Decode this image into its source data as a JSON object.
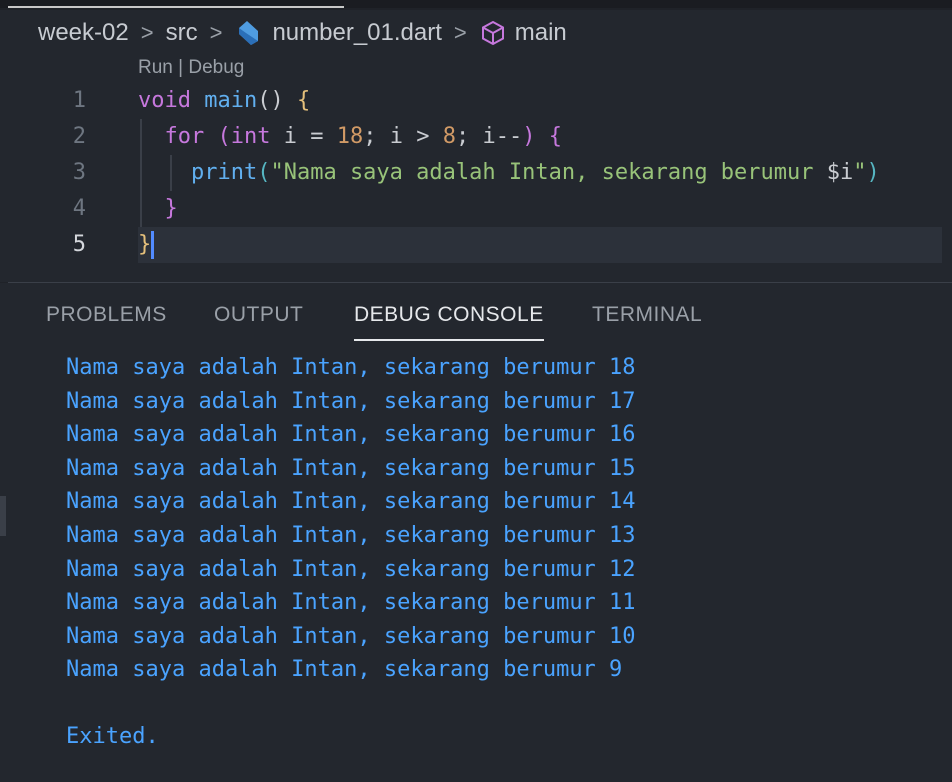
{
  "breadcrumb": {
    "folder1": "week-02",
    "folder2": "src",
    "file": "number_01.dart",
    "symbol": "main",
    "separator": ">"
  },
  "editor": {
    "codelens": {
      "run": "Run",
      "separator": " | ",
      "debug": "Debug"
    },
    "line_numbers": [
      "1",
      "2",
      "3",
      "4",
      "5"
    ],
    "active_line": 5,
    "lines": {
      "l1": {
        "kw": "void",
        "fn": "main",
        "paren": "()",
        "brace": "{"
      },
      "l2": {
        "kw": "for",
        "open": "(",
        "type": "int",
        "var": "i",
        "eq": "=",
        "start": "18",
        "semi1": ";",
        "var2": "i",
        "gt": ">",
        "end": "8",
        "semi2": ";",
        "dec": "i--",
        "close": ")",
        "brace": "{"
      },
      "l3": {
        "fn": "print",
        "open": "(",
        "str": "\"Nama saya adalah Intan, sekarang berumur ",
        "interp": "$i",
        "strend": "\"",
        "close": ")"
      },
      "l4": {
        "brace": "}"
      },
      "l5": {
        "brace": "}"
      }
    }
  },
  "panel": {
    "tabs": [
      "PROBLEMS",
      "OUTPUT",
      "DEBUG CONSOLE",
      "TERMINAL"
    ],
    "active_tab": "DEBUG CONSOLE",
    "output": [
      "Nama saya adalah Intan, sekarang berumur 18",
      "Nama saya adalah Intan, sekarang berumur 17",
      "Nama saya adalah Intan, sekarang berumur 16",
      "Nama saya adalah Intan, sekarang berumur 15",
      "Nama saya adalah Intan, sekarang berumur 14",
      "Nama saya adalah Intan, sekarang berumur 13",
      "Nama saya adalah Intan, sekarang berumur 12",
      "Nama saya adalah Intan, sekarang berumur 11",
      "Nama saya adalah Intan, sekarang berumur 10",
      "Nama saya adalah Intan, sekarang berumur 9"
    ],
    "exit_message": "Exited."
  },
  "colors": {
    "background": "#23272e",
    "keyword": "#c678dd",
    "function": "#61afef",
    "number": "#d19a66",
    "string": "#98c379",
    "console_text": "#4aa3ff"
  },
  "icons": {
    "file": "dart-file-icon",
    "symbol": "cube-icon"
  }
}
